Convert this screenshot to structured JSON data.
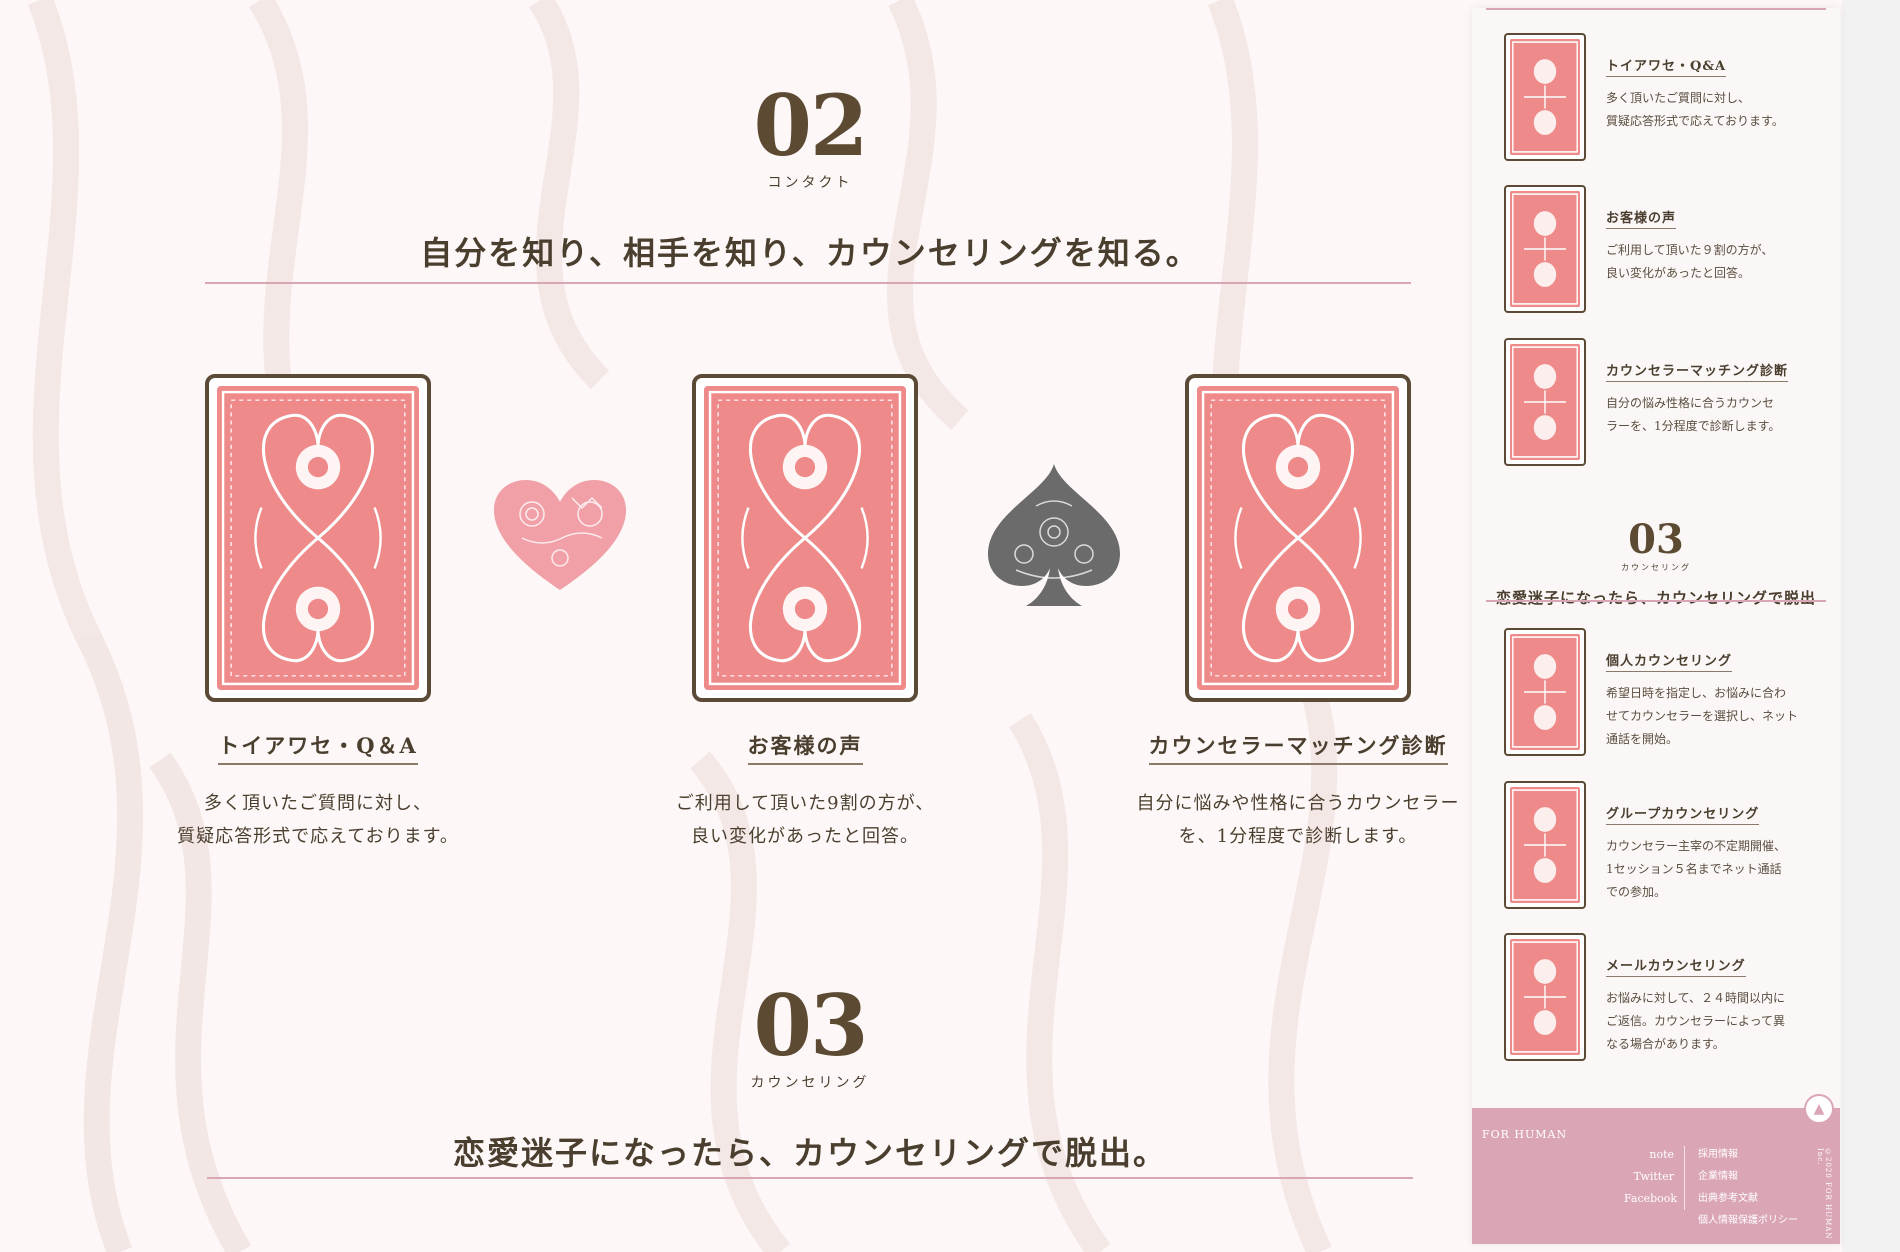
{
  "section02": {
    "number": "02",
    "subtitle": "コンタクト",
    "catch": "自分を知り、相手を知り、カウンセリングを知る。",
    "cards": [
      {
        "title": "トイアワセ・Q＆A",
        "line1": "多く頂いたご質問に対し、",
        "line2": "質疑応答形式で応えております。"
      },
      {
        "title": "お客様の声",
        "line1": "ご利用して頂いた9割の方が、",
        "line2": "良い変化があったと回答。"
      },
      {
        "title": "カウンセラーマッチング診断",
        "line1": "自分に悩みや性格に合うカウンセラー",
        "line2": "を、1分程度で診断します。"
      }
    ]
  },
  "section03": {
    "number": "03",
    "subtitle": "カウンセリング",
    "catch": "恋愛迷子になったら、カウンセリングで脱出。"
  },
  "sidebar": {
    "items_top": [
      {
        "title": "トイアワセ・Q&A",
        "line1": "多く頂いたご質問に対し、",
        "line2": "質疑応答形式で応えております。"
      },
      {
        "title": "お客様の声",
        "line1": "ご利用して頂いた９割の方が、",
        "line2": "良い変化があったと回答。"
      },
      {
        "title": "カウンセラーマッチング診断",
        "line1": "自分の悩み性格に合うカウンセ",
        "line2": "ラーを、1分程度で診断します。"
      }
    ],
    "section03": {
      "number": "03",
      "subtitle": "カウンセリング",
      "catch": "恋愛迷子になったら、カウンセリングで脱出"
    },
    "items_bottom": [
      {
        "title": "個人カウンセリング",
        "line1": "希望日時を指定し、お悩みに合わ",
        "line2": "せてカウンセラーを選択し、ネット",
        "line3": "通話を開始。"
      },
      {
        "title": "グループカウンセリング",
        "line1": "カウンセラー主宰の不定期開催、",
        "line2": "1セッション５名までネット通話",
        "line3": "での参加。"
      },
      {
        "title": "メールカウンセリング",
        "line1": "お悩みに対して、２４時間以内に",
        "line2": "ご返信。カウンセラーによって異",
        "line3": "なる場合があります。"
      }
    ],
    "footer": {
      "logo": "FOR HUMAN",
      "links1": [
        "note",
        "Twitter",
        "Facebook"
      ],
      "links2": [
        "採用情報",
        "企業情報",
        "出典参考文献",
        "個人情報保護ポリシー"
      ],
      "copyright": "©2020 FOR HUMAN Inc.",
      "to_top_icon": "arrow-up-icon"
    }
  },
  "colors": {
    "card_pink": "#ef8a8a",
    "frame_brown": "#5b4a36",
    "accent_pink": "#daa5b5",
    "text": "#4a3e2e"
  }
}
